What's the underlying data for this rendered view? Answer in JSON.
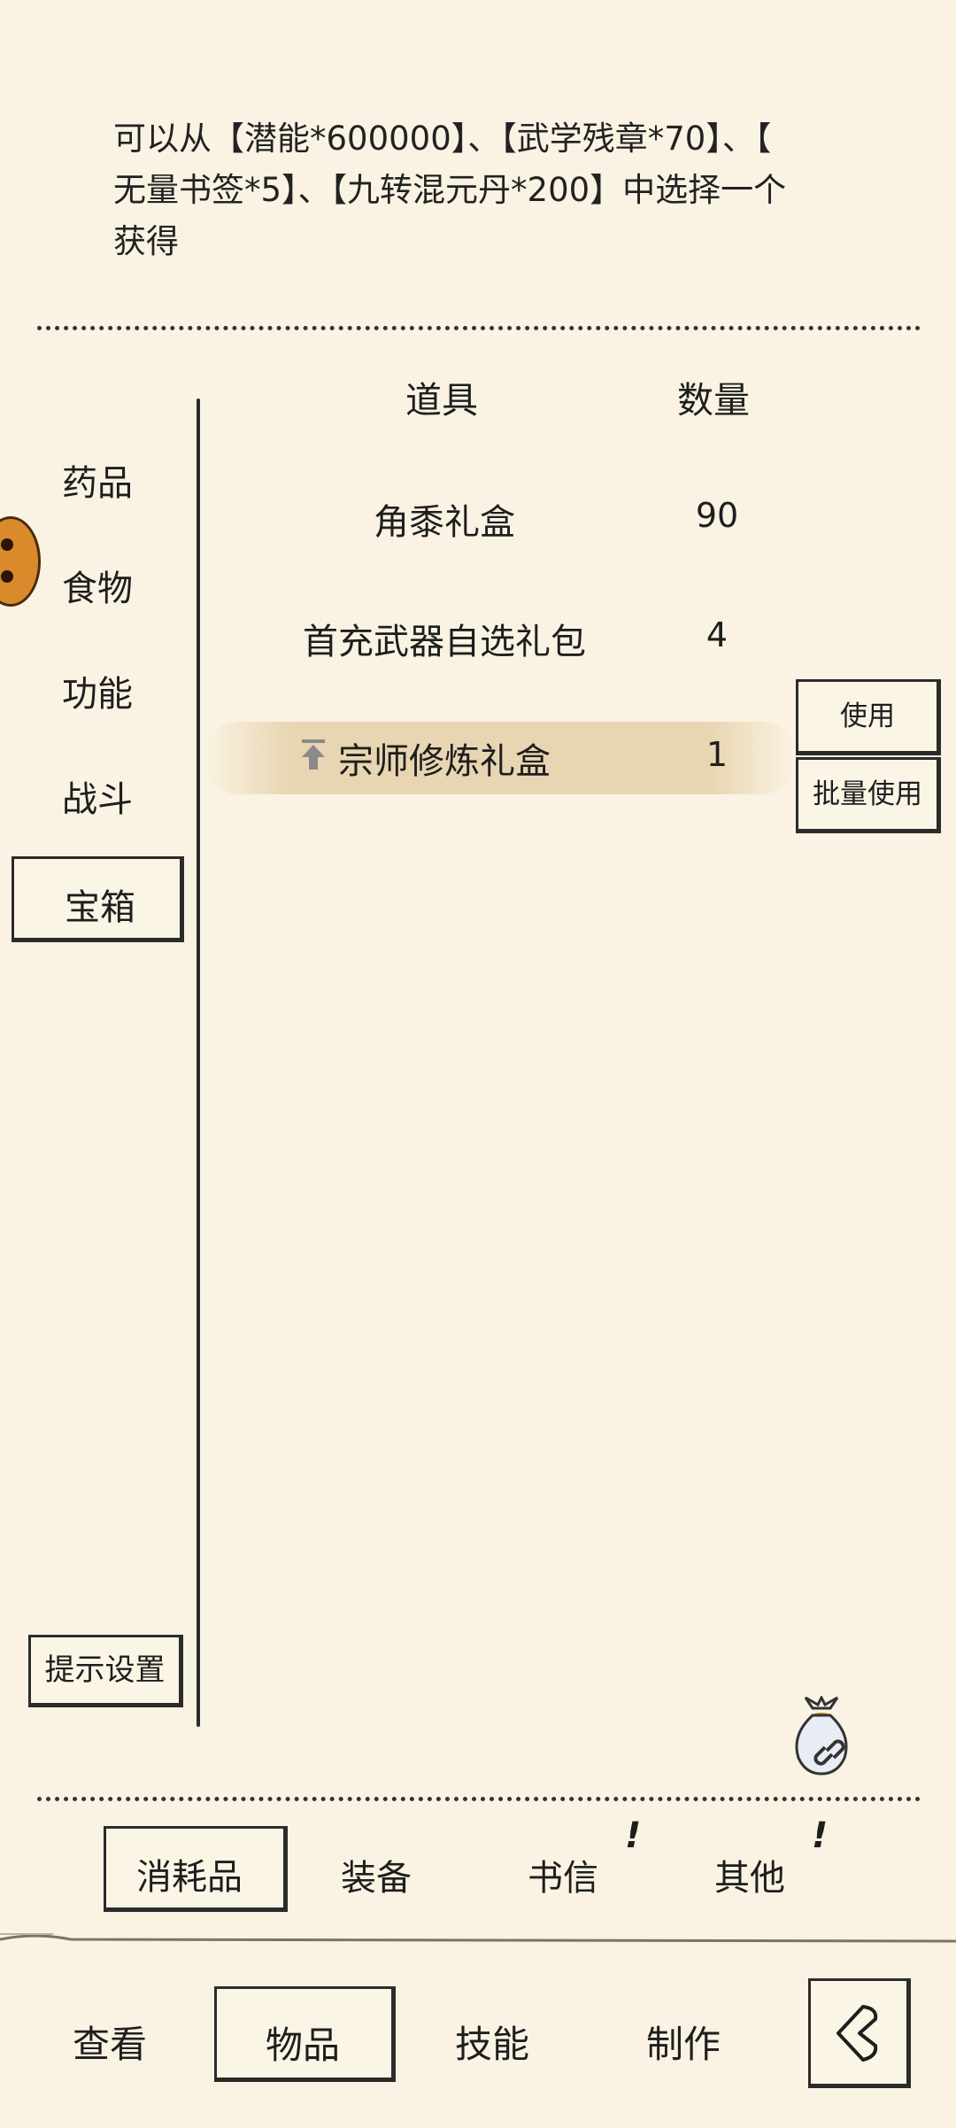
{
  "description": {
    "lines": [
      "可以从【潜能*600000】、【武学残章*70】、【",
      "无量书签*5】、【九转混元丹*200】中选择一个",
      "获得"
    ]
  },
  "table": {
    "col_item": "道具",
    "col_qty": "数量",
    "rows": [
      {
        "name": "角黍礼盒",
        "qty": "90"
      },
      {
        "name": "首充武器自选礼包",
        "qty": "4"
      },
      {
        "name": "宗师修炼礼盒",
        "qty": "1",
        "selected": true
      }
    ]
  },
  "categories": [
    {
      "label": "药品"
    },
    {
      "label": "食物"
    },
    {
      "label": "功能"
    },
    {
      "label": "战斗"
    },
    {
      "label": "宝箱",
      "selected": true
    }
  ],
  "actions": {
    "use": "使用",
    "batch_use": "批量使用",
    "hint_settings": "提示设置"
  },
  "subtabs": [
    {
      "label": "消耗品",
      "selected": true,
      "alert": false
    },
    {
      "label": "装备",
      "alert": false
    },
    {
      "label": "书信",
      "alert": true
    },
    {
      "label": "其他",
      "alert": true
    }
  ],
  "alert_mark": "!",
  "nav": [
    {
      "label": "查看"
    },
    {
      "label": "物品",
      "selected": true
    },
    {
      "label": "技能"
    },
    {
      "label": "制作"
    }
  ],
  "icons": {
    "upgrade": "upgrade-arrow-icon",
    "bag": "bag-icon",
    "back": "back-chevron-icon",
    "avatar": "avatar-icon"
  },
  "colors": {
    "background": "#faf3e3",
    "ink": "#1e1e1e",
    "highlight": "#e2cba0"
  }
}
